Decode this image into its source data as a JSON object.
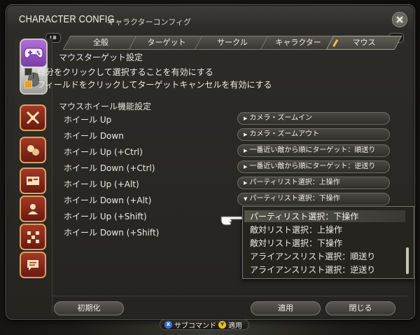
{
  "window": {
    "title_en": "CHARACTER CONFIG",
    "title_jp": "キャラクターコンフィグ",
    "lb": "LB",
    "rb": "RB"
  },
  "tabs": [
    {
      "label": "全般"
    },
    {
      "label": "ターゲット"
    },
    {
      "label": "サークル"
    },
    {
      "label": "キャラクター"
    },
    {
      "label": "マウス",
      "active": true
    }
  ],
  "mouse_target": {
    "title": "マウスターゲット設定",
    "options": [
      {
        "label": "自分をクリックして選択することを有効にする",
        "checked": false
      },
      {
        "label": "フィールドをクリックしてターゲットキャンセルを有効にする",
        "checked": true
      }
    ]
  },
  "wheel": {
    "title": "マウスホイール機能設定",
    "rows": [
      {
        "label": "ホイール Up",
        "value": "カメラ・ズームイン"
      },
      {
        "label": "ホイール Down",
        "value": "カメラ・ズームアウト"
      },
      {
        "label": "ホイール Up (+Ctrl)",
        "value": "一番近い敵から順にターゲット：順送り"
      },
      {
        "label": "ホイール Down (+Ctrl)",
        "value": "一番近い敵から順にターゲット：逆送り"
      },
      {
        "label": "ホイール Up (+Alt)",
        "value": "パーティリスト選択：上操作"
      },
      {
        "label": "ホイール Down (+Alt)",
        "value": "パーティリスト選択：下操作"
      },
      {
        "label": "ホイール Up (+Shift)",
        "value": ""
      },
      {
        "label": "ホイール Down (+Shift)",
        "value": ""
      }
    ]
  },
  "popup": {
    "options": [
      "パーティリスト選択：下操作",
      "敵対リスト選択：上操作",
      "敵対リスト選択：下操作",
      "アライアンスリスト選択：順送り",
      "アライアンスリスト選択：逆送り"
    ],
    "selected_index": 0
  },
  "buttons": {
    "reset": "初期化",
    "apply": "適用",
    "close": "閉じる"
  },
  "hint": {
    "x_label": "サブコマンド",
    "y_label": "適用",
    "x_key": "X",
    "y_key": "Y"
  },
  "colors": {
    "accent": "#e8a020",
    "sidebar_icon": "#a33826",
    "mouse_mode": "#9b5cc8"
  },
  "sidebar_icons": [
    "target-icon",
    "combat-icon",
    "card-icon",
    "character-icon",
    "pattern-icon",
    "chat-icon"
  ]
}
